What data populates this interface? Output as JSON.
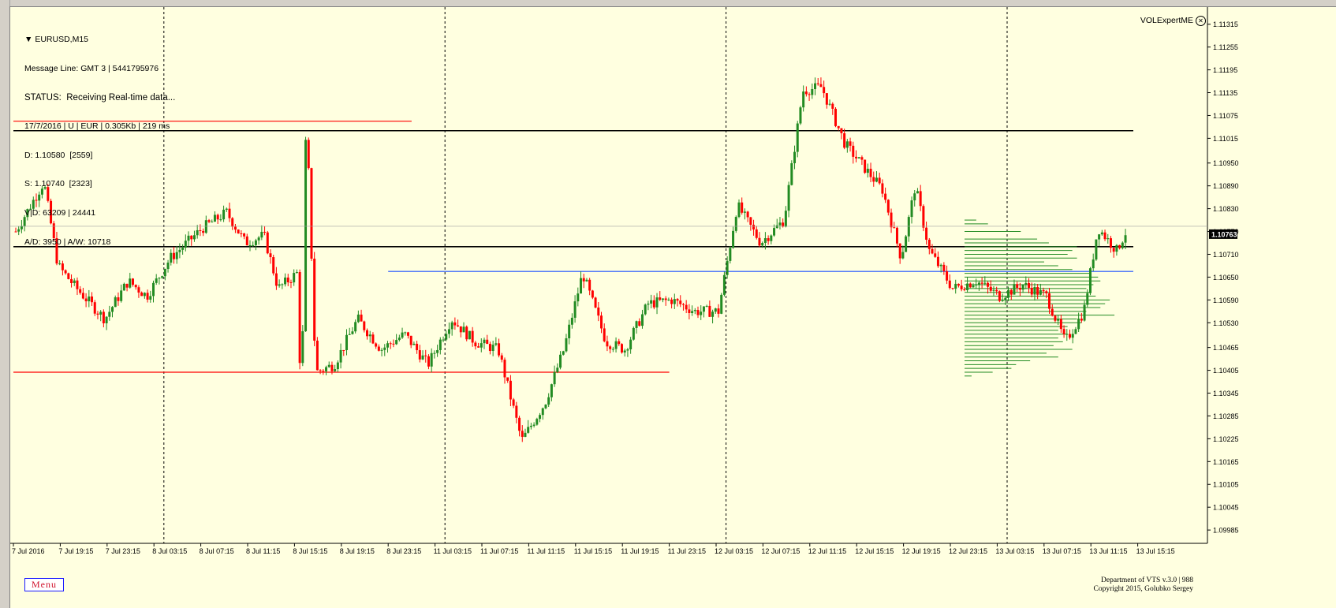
{
  "info": {
    "symbol": "EURUSD,M15",
    "message_line": "Message Line: GMT 3 | 5441795976",
    "status": "STATUS:  Receiving Real-time data...",
    "date_line": "17/7/2016 | U | EUR | 0.305Kb | 219 ms",
    "d_line": "D: 1.10580  [2559]",
    "s_line": "S: 1.10740  [2323]",
    "vd_line": "V|D: 63209 | 24441",
    "aw_line": "A/D: 3950 | A/W: 10718"
  },
  "expert": {
    "name": "VOLExpertME",
    "close_icon": "close-circle-icon"
  },
  "menu": {
    "label": "Menu"
  },
  "credits": {
    "line1": "Department of VTS  v.3.0 | 988",
    "line2": "Copyright 2015, Golubko Sergey"
  },
  "colors": {
    "background": "#ffffe0",
    "bull": "#228b22",
    "bear": "#ff0000",
    "grid_line": "#000000",
    "blue_line": "#1e50ff",
    "price_tag": "#000000"
  },
  "chart_data": {
    "type": "candlestick",
    "symbol": "EURUSD",
    "timeframe": "M15",
    "ylim": [
      1.0995,
      1.1136
    ],
    "y_ticks": [
      "1.11315",
      "1.11255",
      "1.11195",
      "1.11135",
      "1.11075",
      "1.11015",
      "1.10950",
      "1.10890",
      "1.10830",
      "1.10770",
      "1.10710",
      "1.10650",
      "1.10590",
      "1.10530",
      "1.10465",
      "1.10405",
      "1.10345",
      "1.10285",
      "1.10225",
      "1.10165",
      "1.10105",
      "1.10045",
      "1.09985"
    ],
    "current_price": "1.10763",
    "x_ticks": [
      "7 Jul 2016",
      "7 Jul 19:15",
      "7 Jul 23:15",
      "8 Jul 03:15",
      "8 Jul 07:15",
      "8 Jul 11:15",
      "8 Jul 15:15",
      "8 Jul 19:15",
      "8 Jul 23:15",
      "11 Jul 03:15",
      "11 Jul 07:15",
      "11 Jul 11:15",
      "11 Jul 15:15",
      "11 Jul 19:15",
      "11 Jul 23:15",
      "12 Jul 03:15",
      "12 Jul 07:15",
      "12 Jul 11:15",
      "12 Jul 15:15",
      "12 Jul 19:15",
      "12 Jul 23:15",
      "13 Jul 03:15",
      "13 Jul 07:15",
      "13 Jul 11:15",
      "13 Jul 15:15"
    ],
    "day_separators_at_tick": [
      2,
      8,
      14,
      20
    ],
    "horizontal_levels": [
      {
        "price": 1.11035,
        "color": "#000000",
        "from_tick": 0,
        "to_tick": 24
      },
      {
        "price": 1.1073,
        "color": "#000000",
        "from_tick": 0,
        "to_tick": 24
      },
      {
        "price": 1.10665,
        "color": "#1e50ff",
        "from_tick": 8,
        "to_tick": 24
      },
      {
        "price": 1.1106,
        "color": "#ff0000",
        "from_tick": 0,
        "to_tick": 8.5
      },
      {
        "price": 1.104,
        "color": "#ff0000",
        "from_tick": 0,
        "to_tick": 14
      }
    ],
    "volume_profile": {
      "color": "#228b22",
      "from_tick": 20,
      "bins": [
        {
          "price": 1.108,
          "len": 0.25
        },
        {
          "price": 1.1079,
          "len": 0.5
        },
        {
          "price": 1.1077,
          "len": 1.2
        },
        {
          "price": 1.1075,
          "len": 1.55
        },
        {
          "price": 1.1074,
          "len": 1.8
        },
        {
          "price": 1.1073,
          "len": 2.4
        },
        {
          "price": 1.1072,
          "len": 2.3
        },
        {
          "price": 1.1071,
          "len": 2.2
        },
        {
          "price": 1.107,
          "len": 2.4
        },
        {
          "price": 1.1069,
          "len": 1.7
        },
        {
          "price": 1.1068,
          "len": 2.0
        },
        {
          "price": 1.1067,
          "len": 2.3
        },
        {
          "price": 1.1066,
          "len": 2.7
        },
        {
          "price": 1.1065,
          "len": 2.85
        },
        {
          "price": 1.1064,
          "len": 2.9
        },
        {
          "price": 1.1063,
          "len": 2.75
        },
        {
          "price": 1.1062,
          "len": 2.6
        },
        {
          "price": 1.1061,
          "len": 2.7
        },
        {
          "price": 1.106,
          "len": 2.8
        },
        {
          "price": 1.1059,
          "len": 3.1
        },
        {
          "price": 1.1058,
          "len": 3.0
        },
        {
          "price": 1.1057,
          "len": 2.9
        },
        {
          "price": 1.1056,
          "len": 2.6
        },
        {
          "price": 1.1055,
          "len": 3.2
        },
        {
          "price": 1.1054,
          "len": 2.4
        },
        {
          "price": 1.1053,
          "len": 2.5
        },
        {
          "price": 1.1052,
          "len": 2.2
        },
        {
          "price": 1.1051,
          "len": 2.0
        },
        {
          "price": 1.105,
          "len": 2.2
        },
        {
          "price": 1.1049,
          "len": 2.0
        },
        {
          "price": 1.1048,
          "len": 2.1
        },
        {
          "price": 1.1047,
          "len": 1.9
        },
        {
          "price": 1.1046,
          "len": 2.3
        },
        {
          "price": 1.1045,
          "len": 1.75
        },
        {
          "price": 1.1044,
          "len": 2.0
        },
        {
          "price": 1.1043,
          "len": 1.4
        },
        {
          "price": 1.1042,
          "len": 1.1
        },
        {
          "price": 1.1041,
          "len": 1.0
        },
        {
          "price": 1.104,
          "len": 0.6
        },
        {
          "price": 1.1039,
          "len": 0.15
        }
      ]
    },
    "candles_per_tick": 16,
    "price_path": [
      [
        0,
        1.1077
      ],
      [
        0.6,
        1.109
      ],
      [
        0.9,
        1.1068
      ],
      [
        1.3,
        1.1062
      ],
      [
        1.9,
        1.1054
      ],
      [
        2.4,
        1.1064
      ],
      [
        2.8,
        1.106
      ],
      [
        3.3,
        1.107
      ],
      [
        4.0,
        1.1078
      ],
      [
        4.5,
        1.1082
      ],
      [
        4.9,
        1.1074
      ],
      [
        5.3,
        1.1076
      ],
      [
        5.6,
        1.1062
      ],
      [
        6.0,
        1.1066
      ],
      [
        6.1,
        1.103
      ],
      [
        6.2,
        1.111
      ],
      [
        6.4,
        1.104
      ],
      [
        6.8,
        1.1042
      ],
      [
        7.3,
        1.1054
      ],
      [
        7.8,
        1.1046
      ],
      [
        8.3,
        1.105
      ],
      [
        8.8,
        1.1042
      ],
      [
        9.3,
        1.1054
      ],
      [
        9.8,
        1.1048
      ],
      [
        10.3,
        1.1046
      ],
      [
        10.8,
        1.1022
      ],
      [
        11.3,
        1.1032
      ],
      [
        11.7,
        1.1046
      ],
      [
        12.1,
        1.1066
      ],
      [
        12.6,
        1.1048
      ],
      [
        13.0,
        1.1046
      ],
      [
        13.5,
        1.1058
      ],
      [
        14.0,
        1.1059
      ],
      [
        14.5,
        1.1056
      ],
      [
        15.0,
        1.1056
      ],
      [
        15.4,
        1.1084
      ],
      [
        15.9,
        1.1074
      ],
      [
        16.4,
        1.108
      ],
      [
        16.8,
        1.1114
      ],
      [
        17.2,
        1.1115
      ],
      [
        17.7,
        1.11
      ],
      [
        18.1,
        1.1094
      ],
      [
        18.5,
        1.1088
      ],
      [
        18.9,
        1.107
      ],
      [
        19.2,
        1.1089
      ],
      [
        19.5,
        1.1072
      ],
      [
        20.0,
        1.1062
      ],
      [
        20.5,
        1.1064
      ],
      [
        21.0,
        1.106
      ],
      [
        21.5,
        1.1063
      ],
      [
        22.0,
        1.106
      ],
      [
        22.4,
        1.1048
      ],
      [
        22.8,
        1.1056
      ],
      [
        23.1,
        1.1078
      ],
      [
        23.5,
        1.1072
      ],
      [
        23.7,
        1.1077
      ]
    ]
  }
}
